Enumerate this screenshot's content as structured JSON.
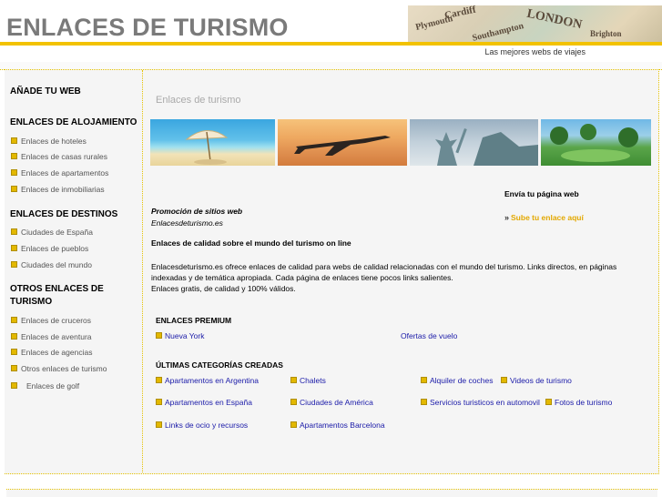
{
  "header": {
    "site_title": "ENLACES DE TURISMO",
    "tagline": "Las mejores webs de viajes",
    "map_words": [
      "Cardiff",
      "Plymouth",
      "LONDON",
      "Southampton",
      "Brighton"
    ]
  },
  "sidebar": {
    "add_web": "AÑADE TU WEB",
    "alojamiento": {
      "heading": "ENLACES DE ALOJAMIENTO",
      "items": [
        "Enlaces de hoteles",
        "Enlaces de casas rurales",
        "Enlaces de apartamentos",
        "Enlaces de inmobiliarias"
      ]
    },
    "destinos": {
      "heading": "ENLACES DE DESTINOS",
      "items": [
        "Ciudades de España",
        "Enlaces de pueblos",
        "Ciudades del mundo"
      ]
    },
    "otros": {
      "heading_line1": "OTROS ENLACES DE",
      "heading_line2": "TURISMO",
      "items": [
        "Enlaces de cruceros",
        "Enlaces de aventura",
        "Enlaces de agencias",
        "Otros enlaces de turismo",
        "Enlaces de golf"
      ]
    }
  },
  "main": {
    "title": "Enlaces de turismo",
    "promo_title": "Promoción de sitios web",
    "promo_site": "Enlacesdeturismo.es",
    "quality_title": "Enlaces de calidad sobre el mundo del turismo on line",
    "paragraph_lines": [
      "Enlacesdeturismo.es ofrece enlaces de calidad para webs de calidad relacionadas con el mundo del turismo. Links directos, en páginas",
      "indexadas y de temática apropiada. Cada página de enlaces tiene pocos links salientes.",
      "Enlaces gratis, de calidad y 100% válidos."
    ],
    "premium_heading": "ENLACES PREMIUM",
    "premium_links": [
      "Nueva York",
      "Ofertas de vuelo"
    ],
    "categories_heading": "ÚLTIMAS CATEGORÍAS CREADAS",
    "categories": [
      "Apartamentos en Argentina",
      "Chalets",
      "Alquiler de coches",
      "Videos de turismo",
      "Apartamentos en España",
      "Ciudades de América",
      "Servicios turisticos en automovil",
      "Fotos de turismo",
      "Links de ocio y recursos",
      "Apartamentos Barcelona"
    ],
    "envia_title": "Envía tu página web",
    "sube_link": "Sube tu enlace aquí"
  },
  "colors": {
    "accent_yellow": "#f2c200",
    "link_blue": "#1a1aa8",
    "title_gray": "#7a7a7a"
  }
}
